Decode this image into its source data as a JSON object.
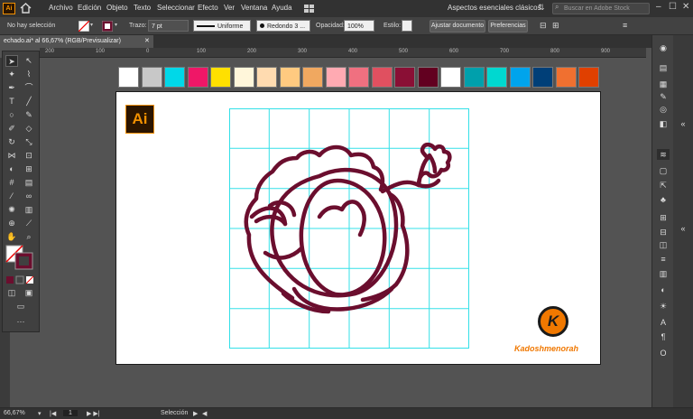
{
  "app": {
    "logo": "Ai"
  },
  "menu": {
    "items": [
      "Archivo",
      "Edición",
      "Objeto",
      "Texto",
      "Seleccionar",
      "Efecto",
      "Ver",
      "Ventana",
      "Ayuda"
    ],
    "workspace": "Aspectos esenciales clásicos",
    "search_placeholder": "Buscar en Adobe Stock"
  },
  "control": {
    "selection_status": "No hay selección",
    "stroke_label": "Trazo:",
    "stroke_weight": "7 pt",
    "stroke_profile": "Uniforme",
    "brush": "Redondo 3 ...",
    "opacity_label": "Opacidad:",
    "opacity_value": "100%",
    "style_label": "Estilo:",
    "adjust_doc_button": "Ajustar documento",
    "preferences_button": "Preferencias"
  },
  "document": {
    "tab_title": "echado.ai* al 66,67% (RGB/Previsualizar)"
  },
  "ruler": {
    "ticks": [
      "200",
      "100",
      "0",
      "100",
      "200",
      "300",
      "400",
      "500",
      "600",
      "700",
      "800",
      "900"
    ]
  },
  "swatches": [
    "#ffffff",
    "#c8c8c8",
    "#00d8e8",
    "#ef1767",
    "#ffe000",
    "#fff6da",
    "#ffdbb0",
    "#ffca80",
    "#f0a860",
    "#ffaab2",
    "#f07080",
    "#e05060",
    "#8a0f35",
    "#620020",
    "#ffffff",
    "#00a0ac",
    "#00d8d0",
    "#00a4ec",
    "#003f78",
    "#f07030",
    "#e04000"
  ],
  "artwork": {
    "badge": "Ai",
    "brand_letter": "K",
    "brand_name": "Kadoshmenorah",
    "stroke_color": "#6b0e2e",
    "grid_color": "#33e0e8"
  },
  "status": {
    "zoom": "66,67%",
    "artboard": "1",
    "tool": "Selección"
  },
  "colors": {
    "accent": "#f29100",
    "k_orange": "#f07800"
  }
}
